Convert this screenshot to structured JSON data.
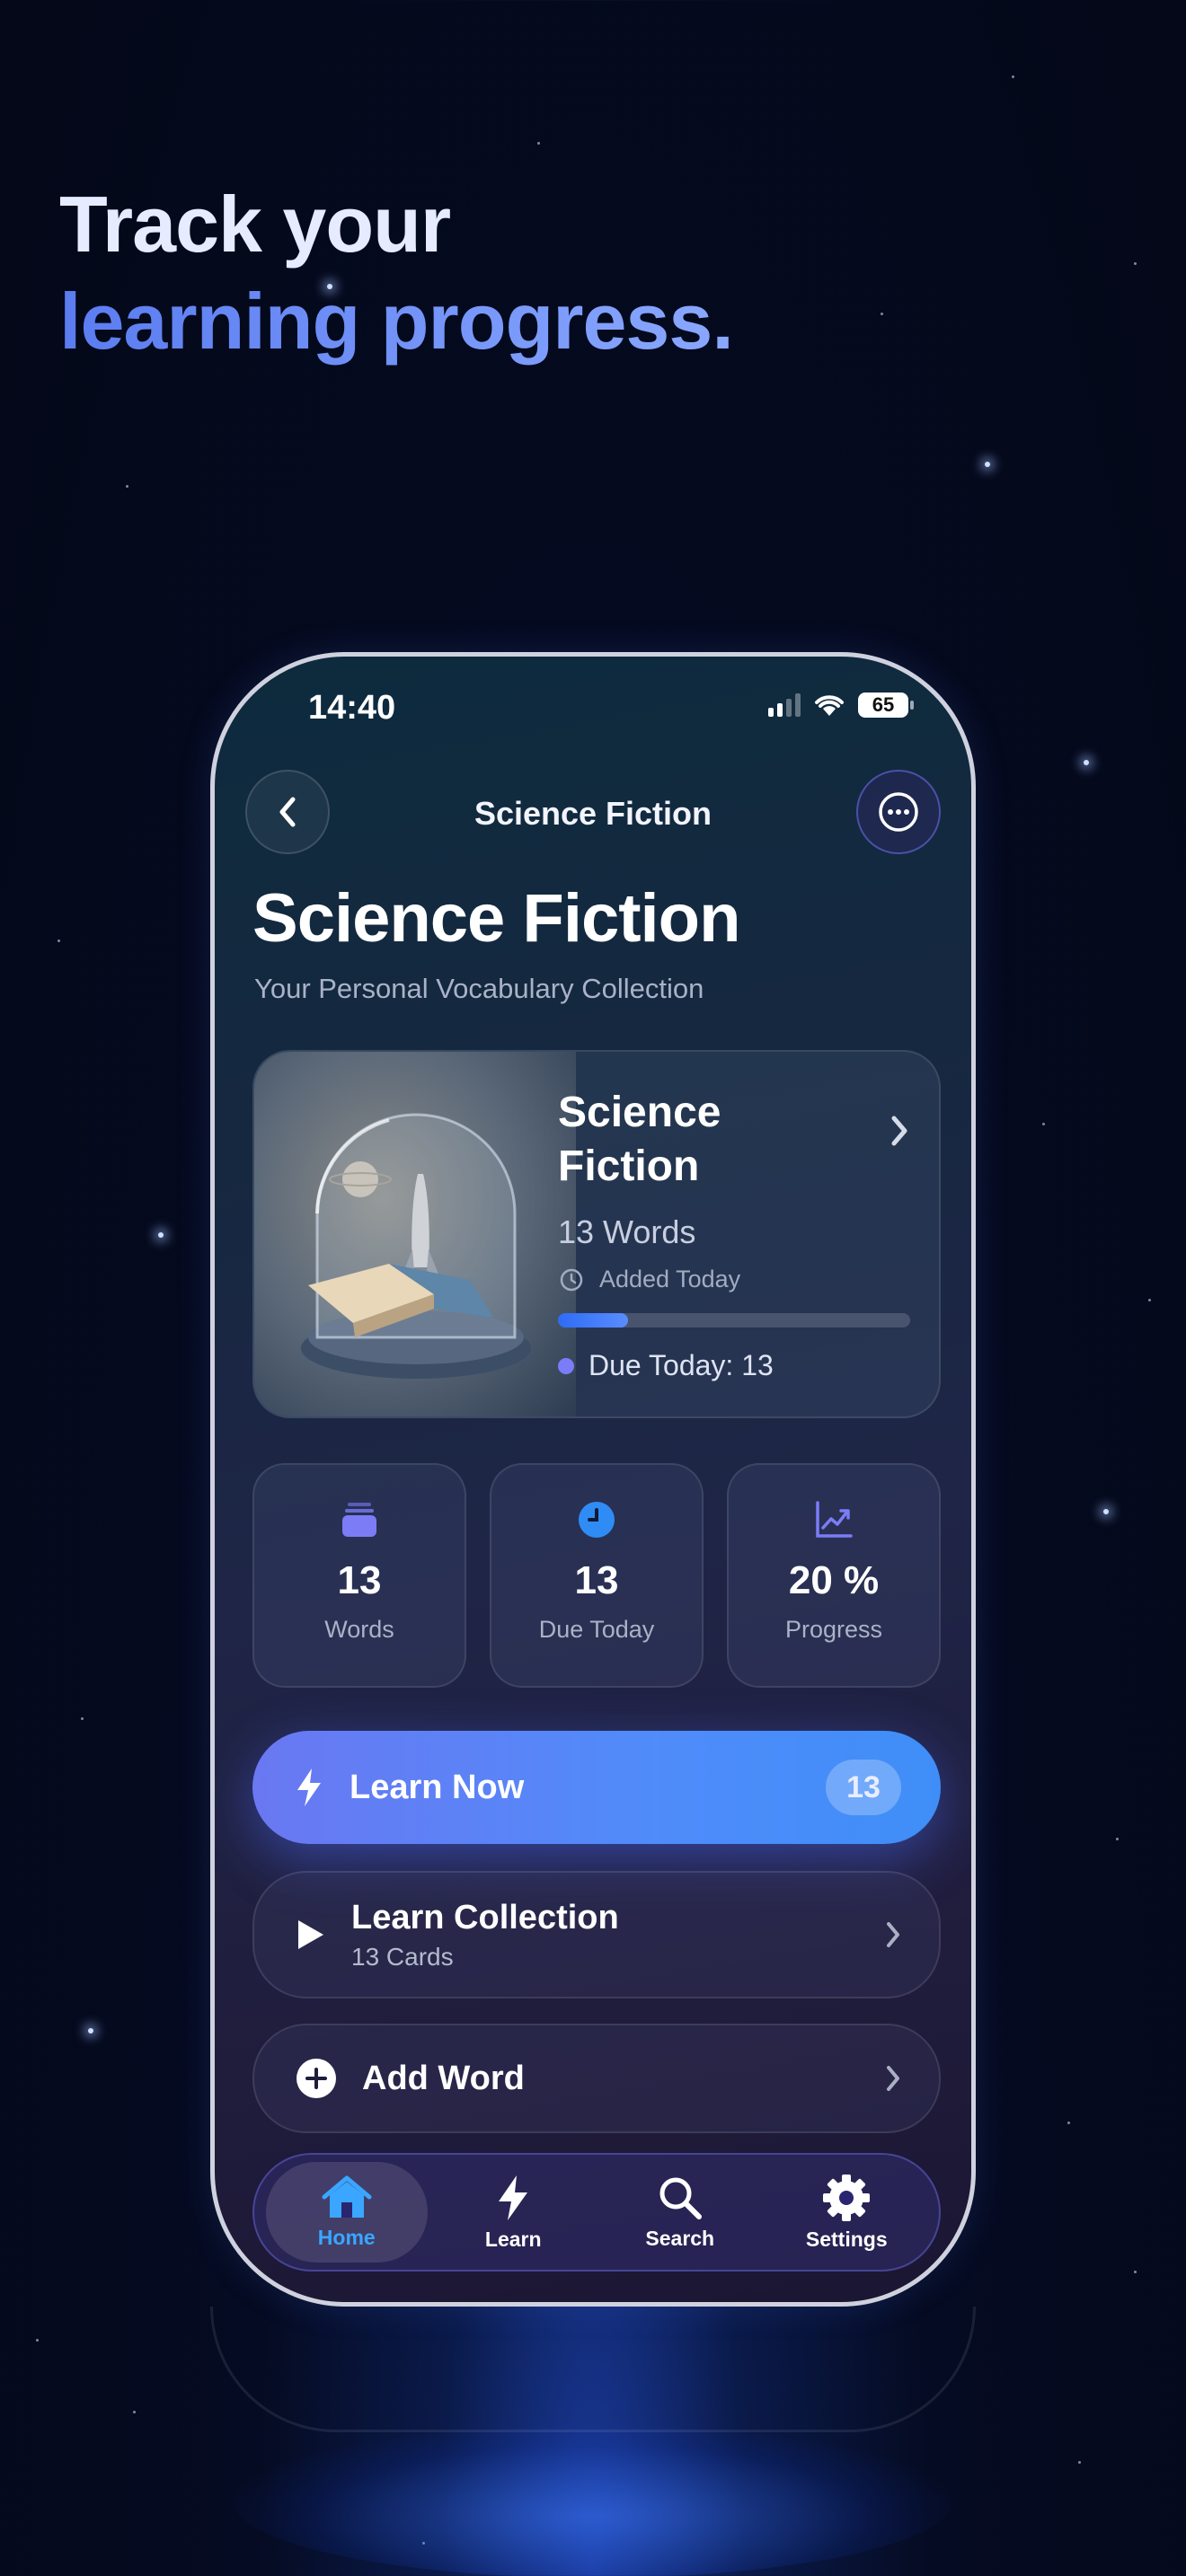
{
  "promo": {
    "headline_line1": "Track your",
    "headline_line2": "learning progress."
  },
  "status_bar": {
    "time": "14:40",
    "battery": "65"
  },
  "nav": {
    "title": "Science Fiction",
    "back_icon": "chevron-left-icon",
    "more_icon": "ellipsis-circle-icon"
  },
  "page": {
    "title": "Science Fiction",
    "subtitle": "Your Personal Vocabulary Collection"
  },
  "collection_card": {
    "name": "Science Fiction",
    "words": "13 Words",
    "added": "Added Today",
    "progress_percent": 20,
    "due": "Due Today: 13"
  },
  "stats": [
    {
      "icon": "stack-icon",
      "value": "13",
      "label": "Words",
      "color": "#7b7cf6"
    },
    {
      "icon": "clock-icon",
      "value": "13",
      "label": "Due Today",
      "color": "#2f8cf5"
    },
    {
      "icon": "chart-icon",
      "value": "20 %",
      "label": "Progress",
      "color": "#7b7cf6"
    }
  ],
  "actions": {
    "learn_now": {
      "label": "Learn Now",
      "badge": "13"
    },
    "learn_collection": {
      "title": "Learn Collection",
      "subtitle": "13 Cards"
    },
    "add_word": {
      "title": "Add Word"
    }
  },
  "tabbar": [
    {
      "label": "Home",
      "icon": "house-icon",
      "active": true
    },
    {
      "label": "Learn",
      "icon": "bolt-icon",
      "active": false
    },
    {
      "label": "Search",
      "icon": "magnifier-icon",
      "active": false
    },
    {
      "label": "Settings",
      "icon": "gear-icon",
      "active": false
    }
  ],
  "colors": {
    "accent": "#4f8cfa",
    "active_tab": "#3aa6ff",
    "background": "#050b22"
  }
}
